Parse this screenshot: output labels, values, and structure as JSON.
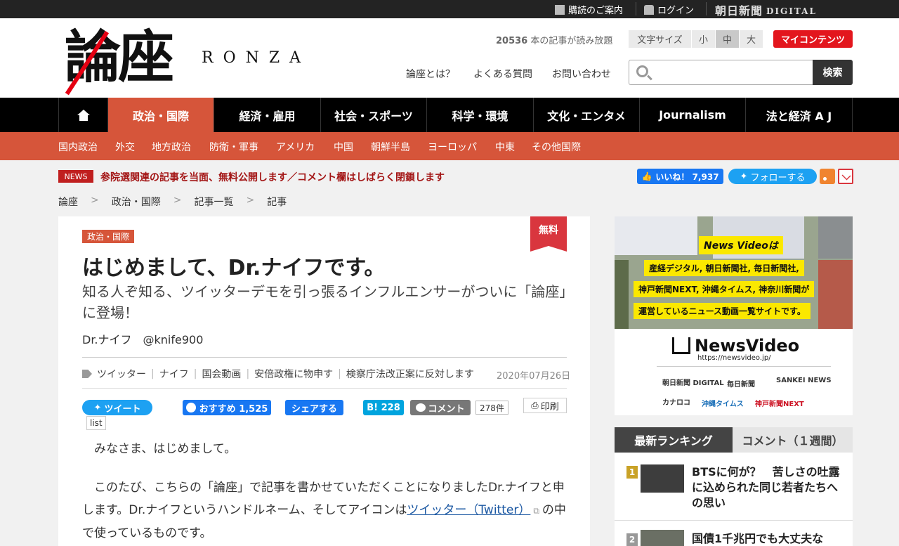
{
  "topbar": {
    "subscribe": "購読のご案内",
    "login": "ログイン",
    "digital_logo": "朝日新聞",
    "digital_sub": "DIGITAL"
  },
  "header": {
    "logo_kanji": "論座",
    "logo_latin": "RONZA",
    "article_count_num": "20536",
    "article_count_text": "本の記事が読み放題",
    "font_size_label": "文字サイズ",
    "font_small": "小",
    "font_medium": "中",
    "font_large": "大",
    "my_contents": "マイコンテンツ",
    "link_about": "論座とは？",
    "link_faq": "よくある質問",
    "link_contact": "お問い合わせ",
    "search_button": "検索",
    "search_placeholder": ""
  },
  "mainnav": [
    "政治・国際",
    "経済・雇用",
    "社会・スポーツ",
    "科学・環境",
    "文化・エンタメ",
    "Journalism",
    "法と経済 A J"
  ],
  "subnav": [
    "国内政治",
    "外交",
    "地方政治",
    "防衛・軍事",
    "アメリカ",
    "中国",
    "朝鮮半島",
    "ヨーロッパ",
    "中東",
    "その他国際"
  ],
  "news": {
    "badge": "NEWS",
    "text": "参院選関連の記事を当面、無料公開します／コメント欄はしばらく閉鎖します",
    "fb_like": "いいね！ 7,937",
    "tw_follow": "フォローする"
  },
  "breadcrumb": [
    "論座",
    "政治・国際",
    "記事一覧",
    "記事"
  ],
  "article": {
    "category": "政治・国際",
    "free_badge": "無料",
    "title": "はじめまして、Dr.ナイフです。",
    "subtitle": "知る人ぞ知る、ツイッターデモを引っ張るインフルエンサーがついに「論座」に登場！",
    "author": "Dr.ナイフ　@knife900",
    "tags": [
      "ツイッター",
      "ナイフ",
      "国会動画",
      "安倍政権に物申す",
      "検察庁法改正案に反対します"
    ],
    "date": "2020年07月26日",
    "tweet": "ツイート",
    "fb_recommend": "おすすめ 1,525",
    "fb_share": "シェアする",
    "hatena": "B! 228",
    "comment": "コメント",
    "comment_count": "278件",
    "print": "印刷",
    "list_tip": "list",
    "p1": "みなさま、はじめまして。",
    "p2_a": "このたび、こちらの「論座」で記事を書かせていただくことになりましたDr.ナイフと申します。Dr.ナイフというハンドルネーム、そしてアイコンは",
    "p2_link": "ツイッター（Twitter）",
    "p2_b": "の中で使っているものです。"
  },
  "ad": {
    "line1": "News Videoは",
    "line2": "産経デジタル, 朝日新聞社, 毎日新聞社,",
    "line3": "神戸新聞NEXT, 沖縄タイムス, 神奈川新聞が",
    "line4": "運営しているニュース動画一覧サイトです。",
    "brand": "NewsVideo",
    "url": "https://newsvideo.jp/",
    "pub1": "朝日新聞 DIGITAL",
    "pub2": "毎日新聞",
    "pub3": "SANKEI NEWS",
    "pub4": "カナロコ",
    "pub5": "沖縄タイムス",
    "pub6": "神戸新聞NEXT"
  },
  "ranking": {
    "tab_latest": "最新ランキング",
    "tab_comments": "コメント（１週間）",
    "items": [
      {
        "rank": "1",
        "title": "BTSに何が？　苦しさの吐露に込められた同じ若者たちへの思い"
      },
      {
        "rank": "2",
        "title": "国債1千兆円でも大丈夫な"
      }
    ]
  }
}
